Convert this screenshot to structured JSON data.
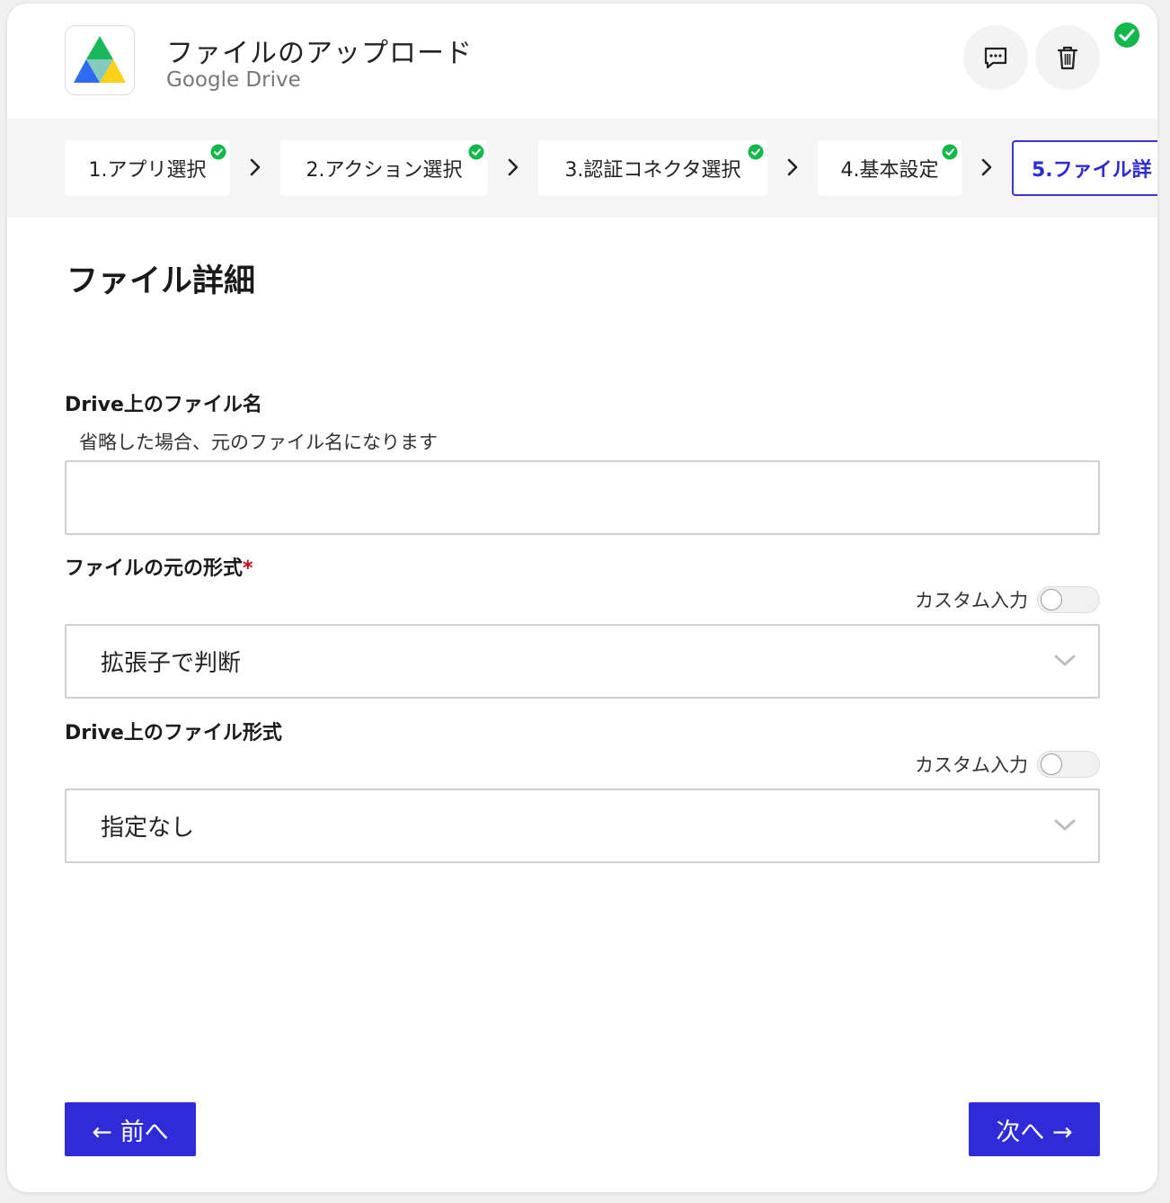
{
  "header": {
    "title": "ファイルのアップロード",
    "subtitle": "Google Drive"
  },
  "steps": [
    {
      "label": "1.アプリ選択",
      "done": true
    },
    {
      "label": "2.アクション選択",
      "done": true
    },
    {
      "label": "3.認証コネクタ選択",
      "done": true
    },
    {
      "label": "4.基本設定",
      "done": true
    },
    {
      "label": "5.ファイル詳",
      "done": false,
      "active": true
    }
  ],
  "section": {
    "title": "ファイル詳細"
  },
  "fields": {
    "filename": {
      "label": "Drive上のファイル名",
      "help": "省略した場合、元のファイル名になります",
      "value": ""
    },
    "source_format": {
      "label": "ファイルの元の形式",
      "required_mark": "*",
      "toggle_label": "カスタム入力",
      "value": "拡張子で判断"
    },
    "drive_format": {
      "label": "Drive上のファイル形式",
      "toggle_label": "カスタム入力",
      "value": "指定なし"
    }
  },
  "nav": {
    "prev_label": "← 前へ",
    "next_label": "次へ →"
  },
  "colors": {
    "accent": "#2f2bd8",
    "success": "#12b94a",
    "required": "#c4001a"
  }
}
